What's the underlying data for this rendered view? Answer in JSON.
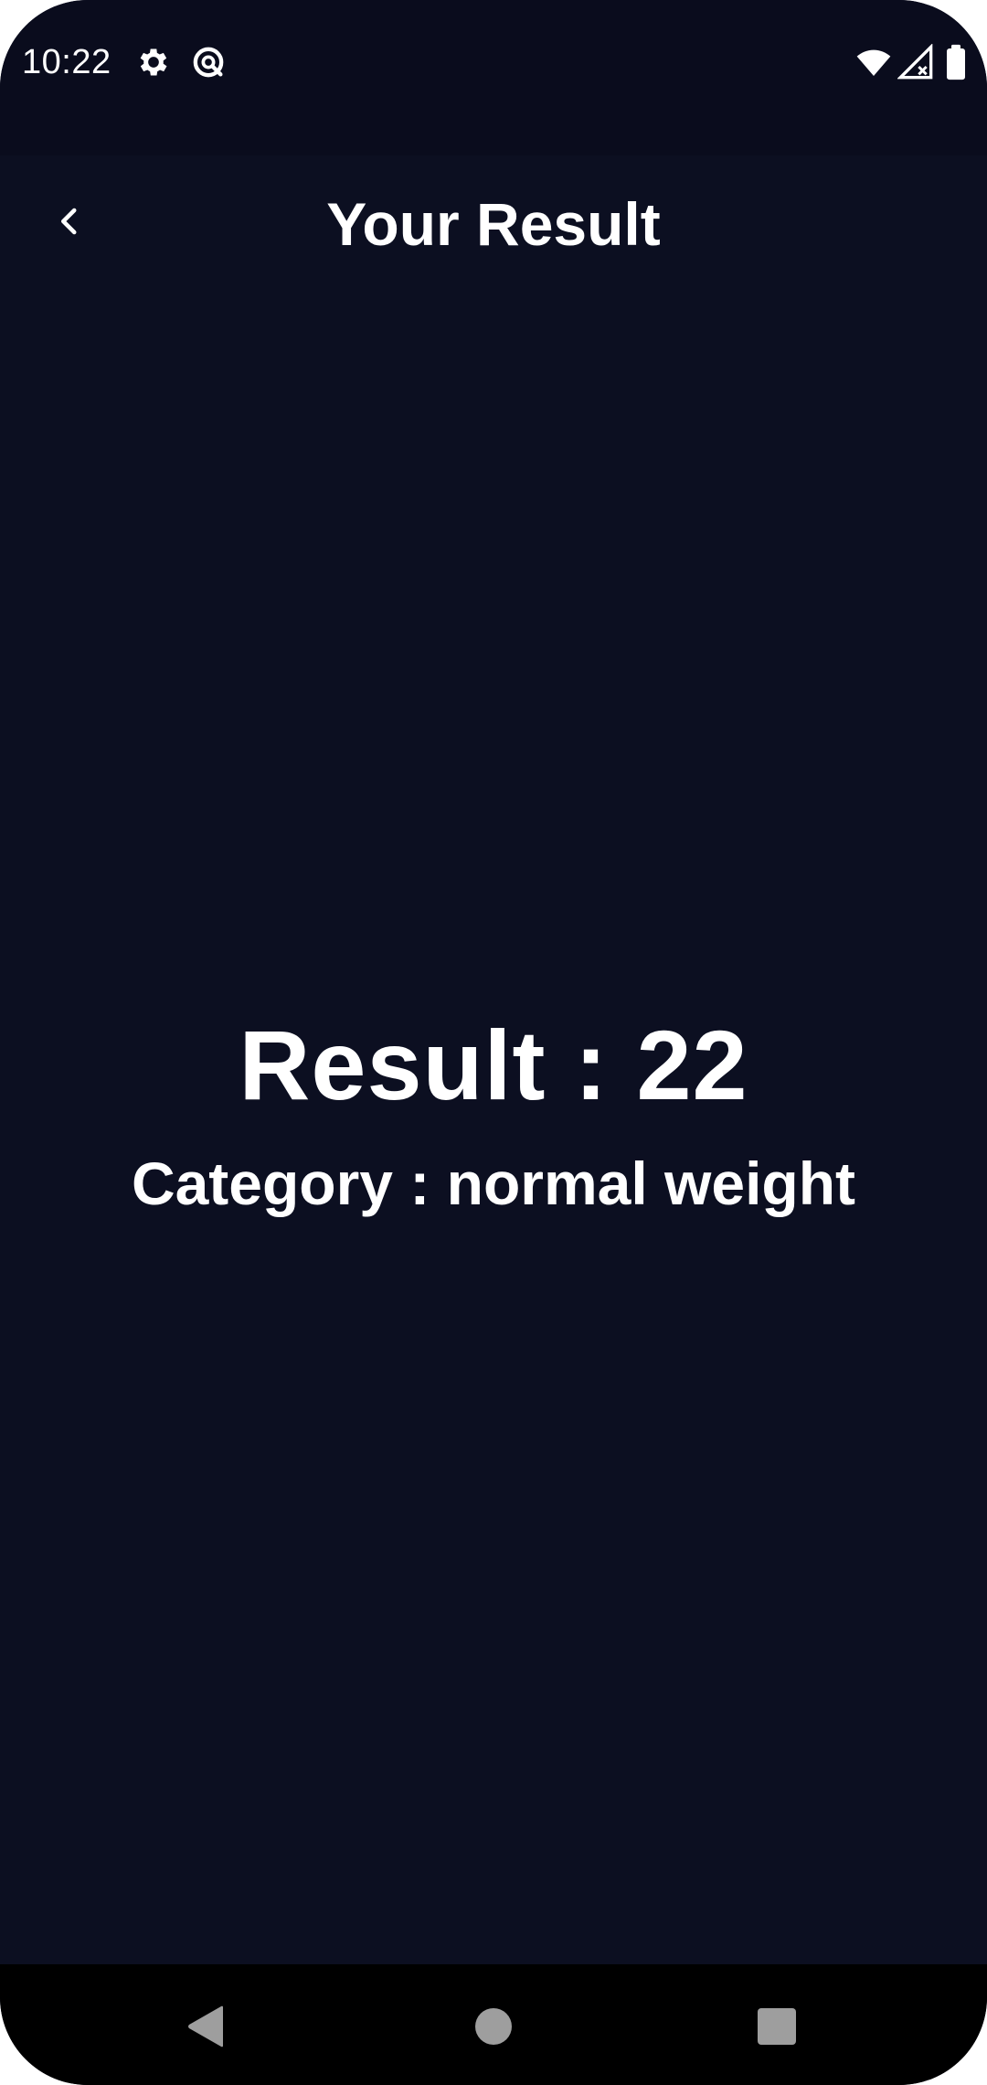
{
  "status_bar": {
    "time": "10:22",
    "icons": [
      "settings-gear-icon",
      "data-saver-icon",
      "wifi-icon",
      "cellular-signal-icon",
      "battery-icon"
    ]
  },
  "app_bar": {
    "title": "Your Result",
    "back_icon": "chevron-left-icon"
  },
  "main": {
    "result_text": "Result : 22",
    "category_text": "Category : normal weight"
  },
  "nav_bar": {
    "icons": [
      "nav-back-triangle-icon",
      "nav-home-circle-icon",
      "nav-recents-square-icon"
    ]
  },
  "colors": {
    "background": "#0c0f21",
    "status_bar_background": "#0a0c1d",
    "text": "#ffffff",
    "nav_bar_background": "#000000",
    "nav_icon": "#9e9e9e"
  }
}
